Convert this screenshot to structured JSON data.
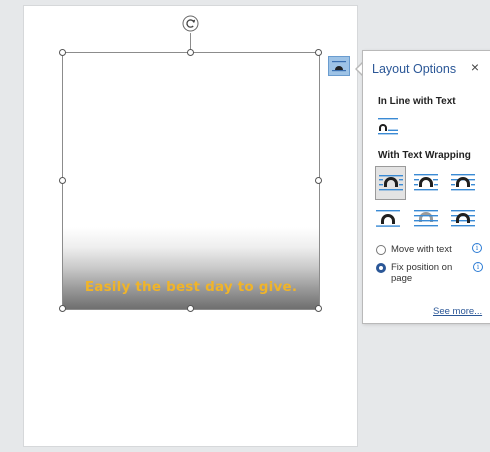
{
  "image": {
    "caption": "Easily the best day to give."
  },
  "layout_options": {
    "title": "Layout Options",
    "close_label": "×",
    "in_line_heading": "In Line with Text",
    "with_wrapping_heading": "With Text Wrapping",
    "selected_wrap": "square",
    "move_with_text": {
      "label": "Move with text",
      "selected": false
    },
    "fix_position": {
      "label_line1": "Fix position on",
      "label_line2": "page",
      "selected": true
    },
    "info_glyph": "i",
    "see_more": "See more..."
  },
  "colors": {
    "accent": "#2b5797",
    "caption": "#f0b429",
    "trigger": "#9ec3e6"
  }
}
